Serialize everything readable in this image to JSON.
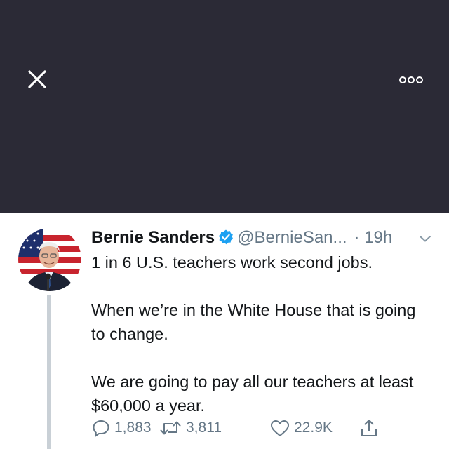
{
  "toolbar": {
    "close_icon": "close-icon",
    "more_icon": "more-options-icon"
  },
  "tweet": {
    "author_name": "Bernie Sanders",
    "verified": true,
    "handle": "@BernieSan...",
    "time": "· 19h",
    "lines": [
      "1 in 6 U.S. teachers work second jobs.",
      "When we’re in the White House that is going to change.",
      "We are going to pay all our teachers at least $60,000 a year."
    ],
    "actions": {
      "replies": "1,883",
      "retweets": "3,811",
      "likes": "22.9K"
    }
  },
  "colors": {
    "top_bar": "#2b2a36",
    "verified": "#1da1f2",
    "muted": "#657786",
    "text": "#14171a",
    "thread_line": "#c9d0d6"
  }
}
